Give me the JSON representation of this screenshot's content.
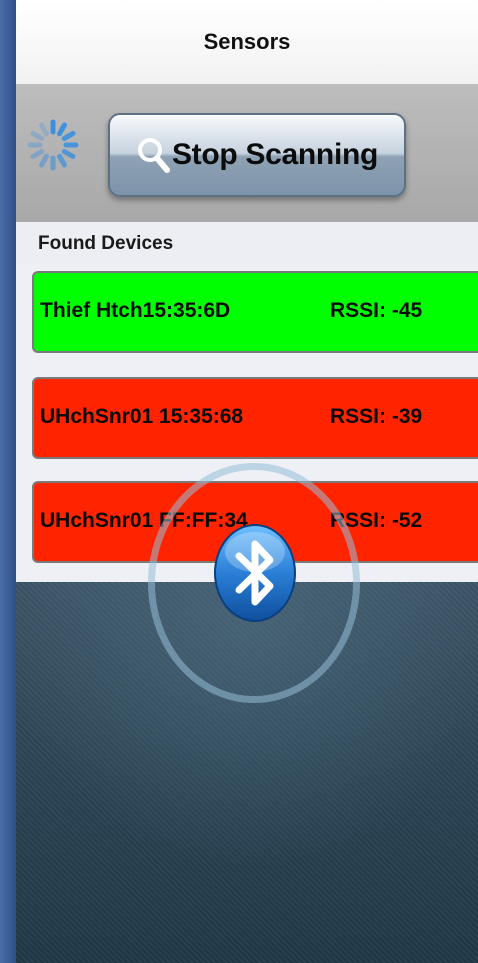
{
  "navbar": {
    "title": "Sensors"
  },
  "toolbar": {
    "scan_button_label": "Stop Scanning"
  },
  "section": {
    "header": "Found Devices"
  },
  "devices": [
    {
      "name": "Thief Htch15:35:6D",
      "rssi": "RSSI: -45",
      "status_color": "#00ff00"
    },
    {
      "name": "UHchSnr01 15:35:68",
      "rssi": "RSSI: -39",
      "status_color": "#ff2400"
    },
    {
      "name": "UHchSnr01 FF:FF:34",
      "rssi": "RSSI: -52",
      "status_color": "#ff2400"
    }
  ],
  "icons": {
    "spinner": "activity-spinner-icon",
    "search": "magnifier-icon",
    "bluetooth": "bluetooth-icon"
  },
  "colors": {
    "accent_blue": "#2a7fd6"
  }
}
